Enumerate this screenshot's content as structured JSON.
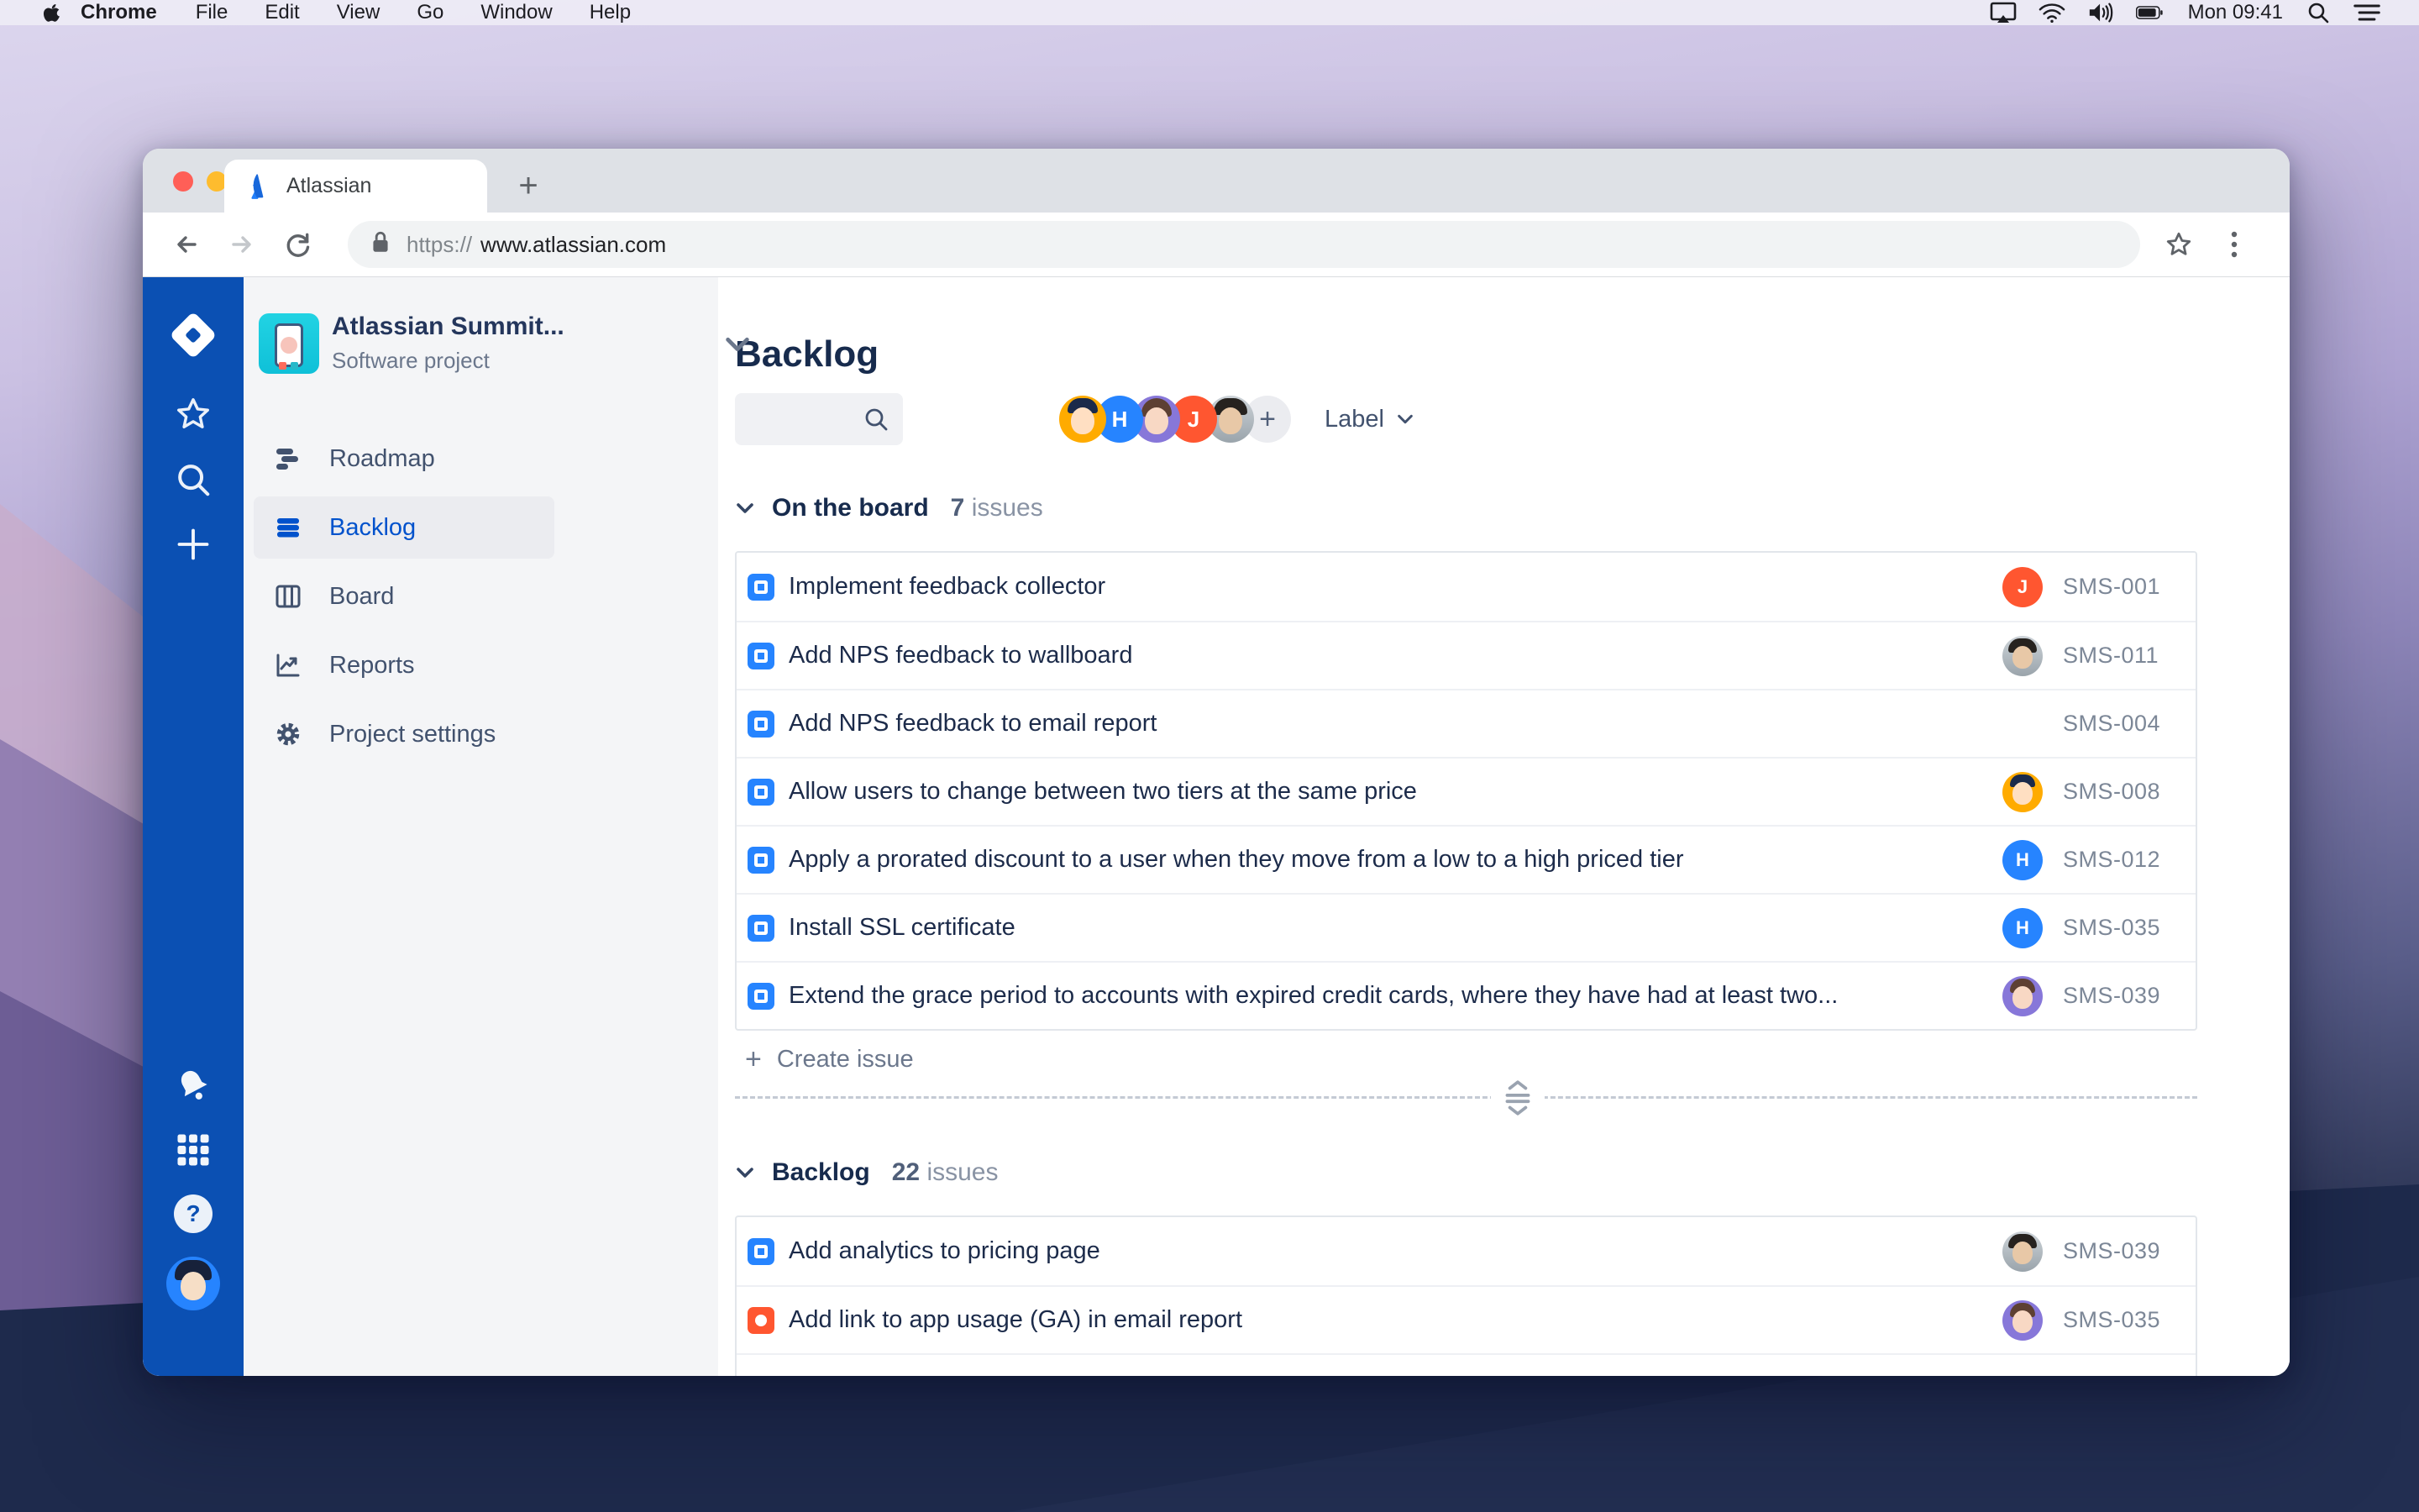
{
  "menu_bar": {
    "app_name": "Chrome",
    "items": [
      "File",
      "Edit",
      "View",
      "Go",
      "Window",
      "Help"
    ],
    "clock": "Mon 09:41"
  },
  "browser": {
    "tab_title": "Atlassian",
    "url_scheme": "https://",
    "url_host": "www.atlassian.com"
  },
  "sidebar": {
    "project": {
      "name": "Atlassian Summit...",
      "type": "Software project"
    },
    "items": [
      {
        "label": "Roadmap"
      },
      {
        "label": "Backlog",
        "active": true
      },
      {
        "label": "Board"
      },
      {
        "label": "Reports"
      },
      {
        "label": "Project settings"
      }
    ]
  },
  "header": {
    "title": "Backlog",
    "label_filter": "Label"
  },
  "avatars": {
    "h_initial": "H",
    "j_initial": "J",
    "add_label": "+",
    "list": [
      {
        "kind": "orange-cartoon"
      },
      {
        "kind": "h-blue",
        "initial": "H",
        "color": "#2684FF"
      },
      {
        "kind": "purple-cartoon"
      },
      {
        "kind": "j-red",
        "initial": "J",
        "color": "#FF5630"
      },
      {
        "kind": "photo-man"
      },
      {
        "kind": "add-button"
      }
    ]
  },
  "board_section": {
    "title": "On the board",
    "count": "7",
    "issues_word": "issues",
    "issues": [
      {
        "type": "story",
        "title": "Implement feedback collector",
        "key": "SMS-001",
        "assignee": "j-red"
      },
      {
        "type": "story",
        "title": "Add NPS feedback to wallboard",
        "key": "SMS-011",
        "assignee": "photo-man"
      },
      {
        "type": "story",
        "title": "Add NPS feedback to email report",
        "key": "SMS-004",
        "assignee": "none"
      },
      {
        "type": "story",
        "title": "Allow users to change between two tiers at the same price",
        "key": "SMS-008",
        "assignee": "orange-cartoon"
      },
      {
        "type": "story",
        "title": "Apply a prorated discount to a user when they move from a low to a high priced tier",
        "key": "SMS-012",
        "assignee": "h-blue"
      },
      {
        "type": "story",
        "title": "Install SSL certificate",
        "key": "SMS-035",
        "assignee": "h-blue"
      },
      {
        "type": "story",
        "title": "Extend the grace period to accounts with expired credit cards, where they have had at least two...",
        "key": "SMS-039",
        "assignee": "purple-cartoon"
      }
    ]
  },
  "backlog_section": {
    "title": "Backlog",
    "count": "22",
    "issues_word": "issues",
    "issues": [
      {
        "type": "story",
        "title": "Add analytics to pricing page",
        "key": "SMS-039",
        "assignee": "photo-man"
      },
      {
        "type": "bug",
        "title": "Add link to app usage (GA) in email report",
        "key": "SMS-035",
        "assignee": "purple-cartoon"
      }
    ]
  },
  "create_issue_label": "Create issue",
  "colors": {
    "sidebar_blue": "#0B50B3",
    "accent_blue": "#0052CC",
    "story_blue": "#2684FF",
    "bug_red": "#FF5630",
    "nav_bg": "#F4F5F7"
  }
}
